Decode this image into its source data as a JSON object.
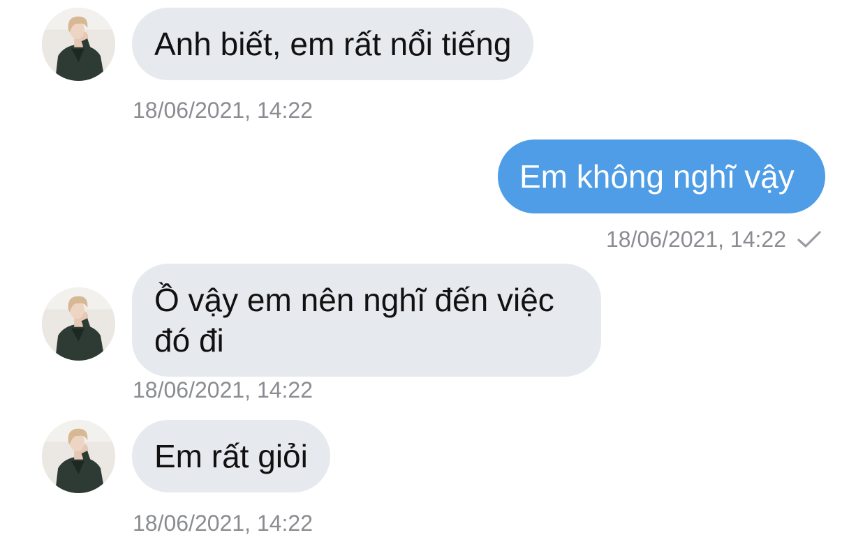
{
  "conversation": {
    "messages": [
      {
        "direction": "incoming",
        "text": "Anh biết, em rất nổi tiếng",
        "timestamp": "18/06/2021, 14:22",
        "avatar": "contact-avatar"
      },
      {
        "direction": "outgoing",
        "text": "Em không nghĩ vậy",
        "timestamp": "18/06/2021, 14:22",
        "status_icon": "check-icon"
      },
      {
        "direction": "incoming",
        "text": "Ồ vậy em nên nghĩ đến việc đó đi",
        "timestamp": "18/06/2021, 14:22",
        "avatar": "contact-avatar"
      },
      {
        "direction": "incoming",
        "text": "Em rất giỏi",
        "timestamp": "18/06/2021, 14:22",
        "avatar": "contact-avatar"
      }
    ]
  },
  "colors": {
    "incoming_bubble": "#e6e9ee",
    "outgoing_bubble": "#4e9de6",
    "timestamp": "#8a8c91"
  }
}
